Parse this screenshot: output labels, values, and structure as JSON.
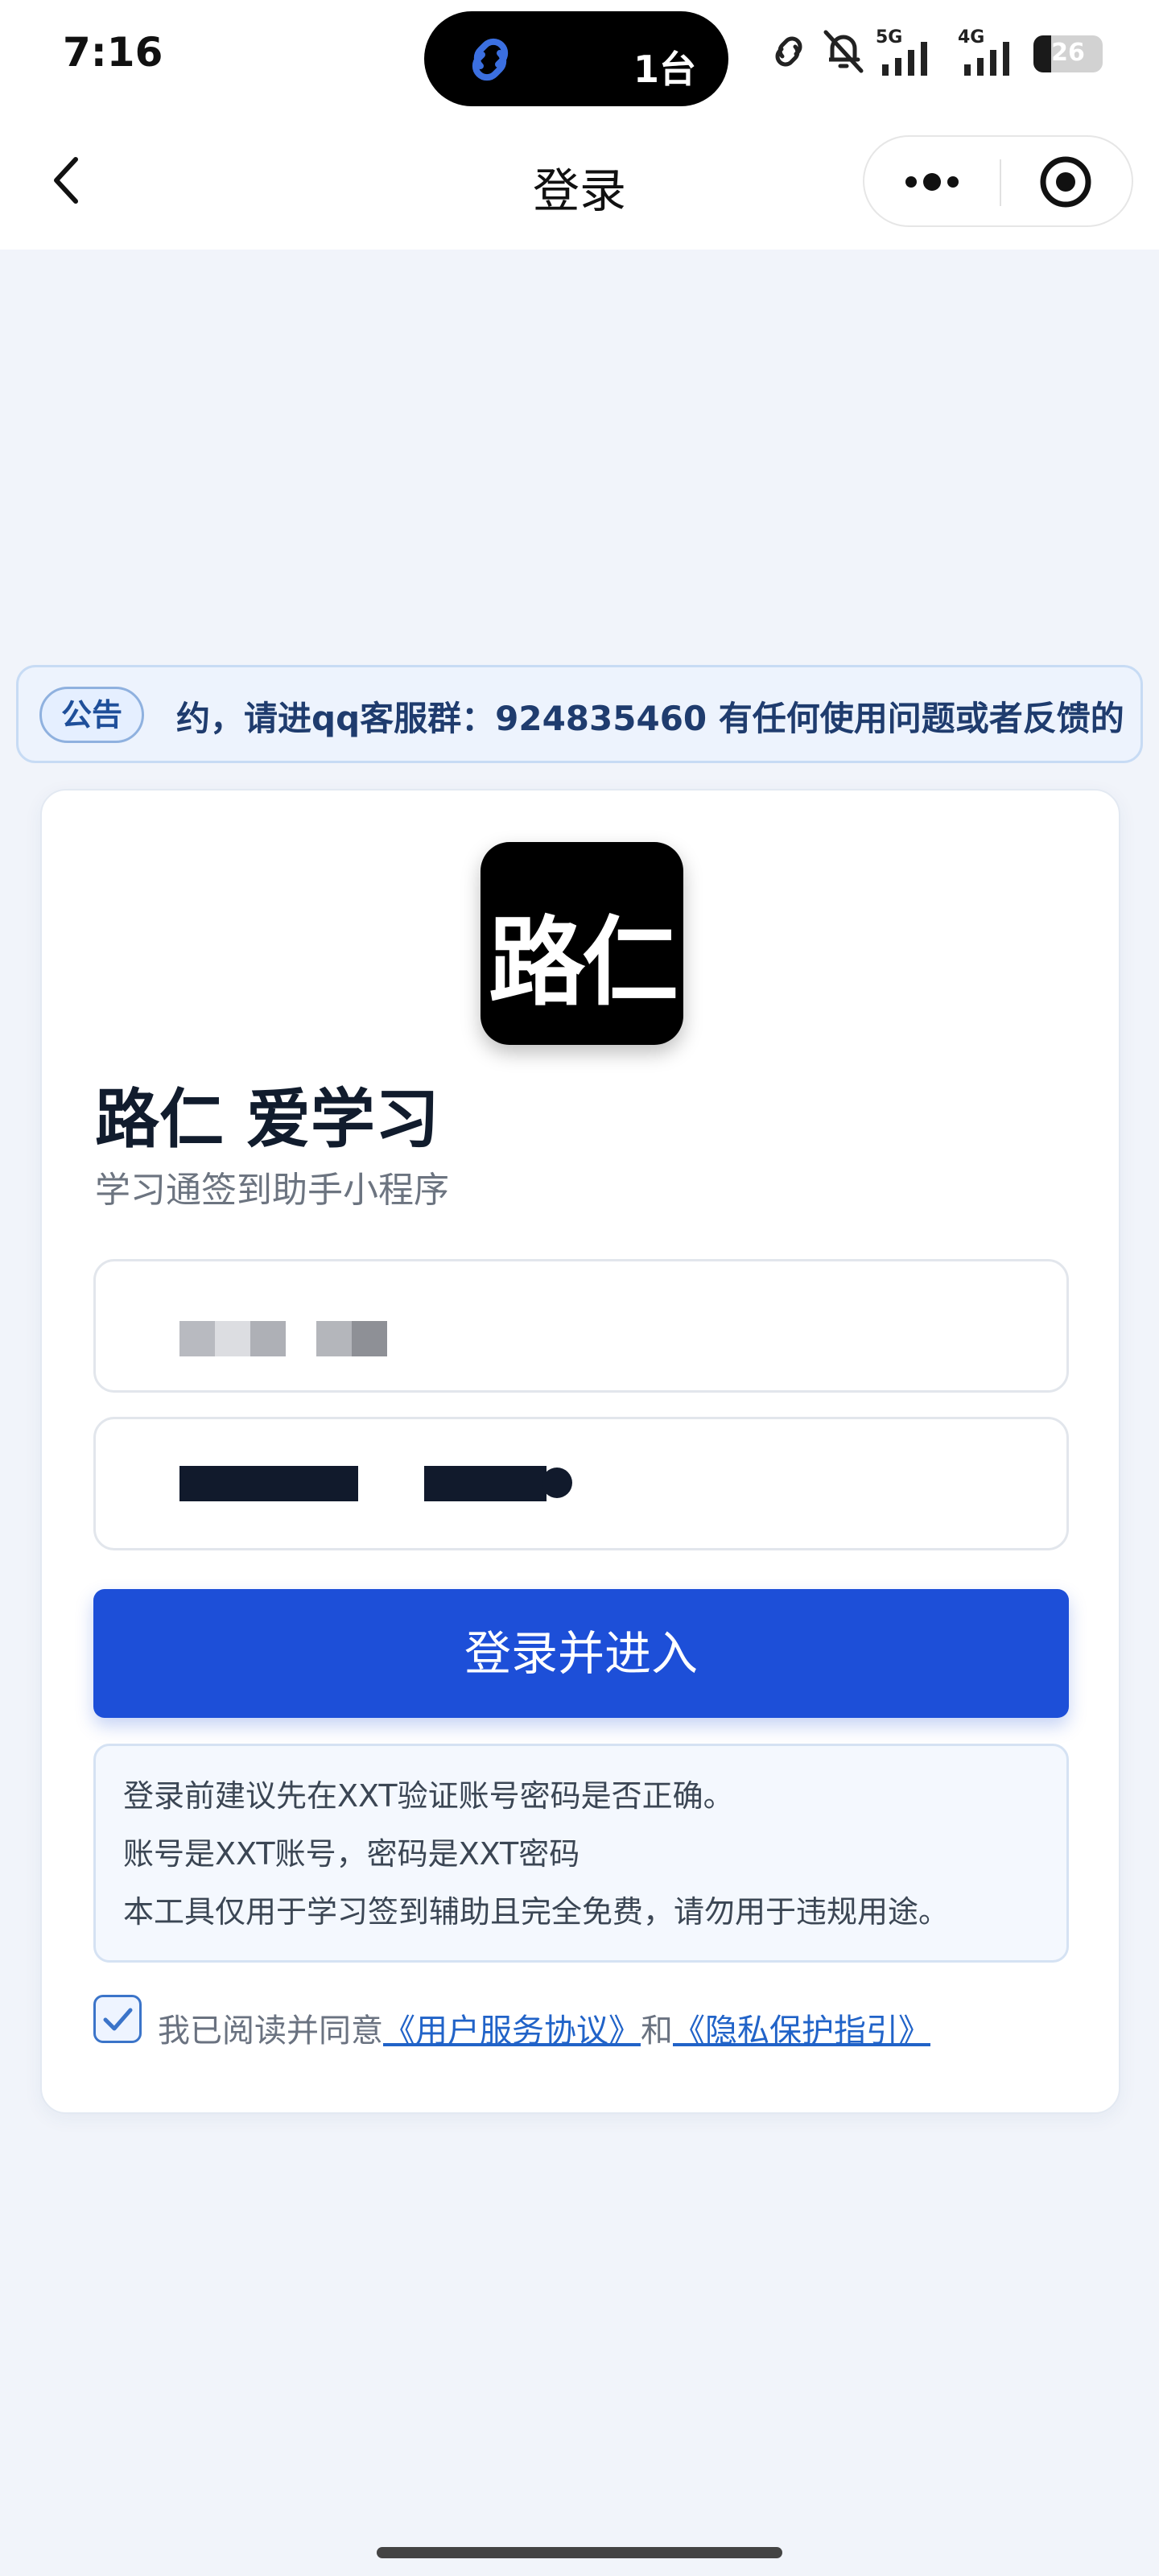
{
  "status_bar": {
    "time": "7:16",
    "island_text": "1台",
    "network_5g": "5G",
    "network_4g": "4G",
    "battery": "26",
    "battery_percent": 26
  },
  "nav": {
    "title": "登录",
    "back_icon": "chevron-left-icon",
    "more_icon": "more-dots-icon",
    "close_icon": "target-circle-icon"
  },
  "notice": {
    "badge": "公告",
    "text": "约，请进qq客服群：924835460 有任何使用问题或者反馈的"
  },
  "app": {
    "logo_text": "路仁",
    "name": "路仁 爱学习",
    "subtitle": "学习通签到助手小程序"
  },
  "form": {
    "login_button": "登录并进入"
  },
  "tips": {
    "line1": "登录前建议先在XXT验证账号密码是否正确。",
    "line2": "账号是XXT账号，密码是XXT密码",
    "line3": "本工具仅用于学习签到辅助且完全免费，请勿用于违规用途。"
  },
  "agreement": {
    "prefix": "我已阅读并同意",
    "terms_link": "《用户服务协议》",
    "conjunction": "和",
    "privacy_link": "《隐私保护指引》",
    "checked": true
  },
  "colors": {
    "primary": "#1d4fd8",
    "link": "#2163c8",
    "background": "#f1f4fa"
  }
}
